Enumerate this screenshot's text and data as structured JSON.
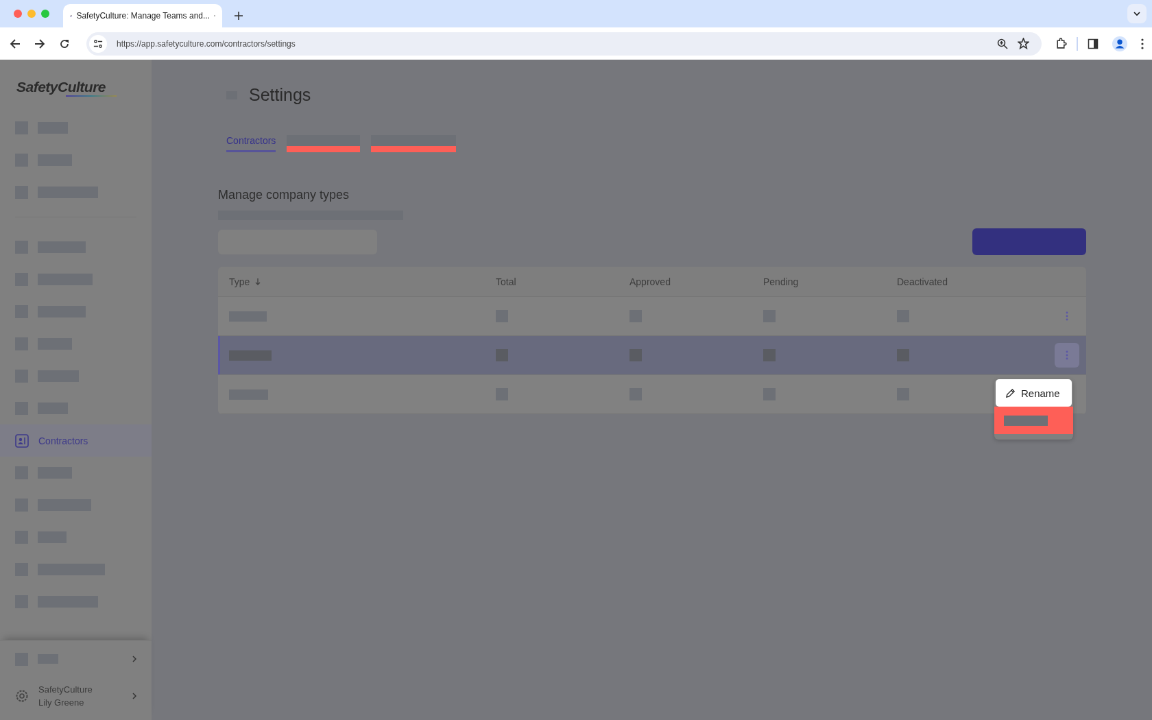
{
  "browser": {
    "tab_title": "SafetyCulture: Manage Teams and...",
    "url": "https://app.safetyculture.com/contractors/settings"
  },
  "sidebar": {
    "logo": "SafetyCulture",
    "items": [
      {
        "kind": "redacted",
        "selected": false
      },
      {
        "kind": "redacted",
        "selected": false
      },
      {
        "kind": "redacted",
        "selected": false
      },
      {
        "kind": "divider"
      },
      {
        "kind": "redacted",
        "selected": false
      },
      {
        "kind": "redacted",
        "selected": false
      },
      {
        "kind": "redacted",
        "selected": false
      },
      {
        "kind": "redacted",
        "selected": false
      },
      {
        "kind": "redacted",
        "selected": false
      },
      {
        "kind": "redacted",
        "selected": false
      },
      {
        "kind": "link",
        "label": "Contractors",
        "selected": true
      },
      {
        "kind": "redacted",
        "selected": false
      },
      {
        "kind": "redacted",
        "selected": false
      },
      {
        "kind": "redacted",
        "selected": false
      },
      {
        "kind": "redacted",
        "selected": false
      },
      {
        "kind": "redacted",
        "selected": false
      }
    ],
    "footer": {
      "organization": "SafetyCulture",
      "user": "Lily Greene"
    }
  },
  "page": {
    "title": "Settings",
    "tabs": [
      {
        "kind": "link",
        "label": "Contractors",
        "selected": true
      },
      {
        "kind": "redacted",
        "selected": false
      },
      {
        "kind": "redacted",
        "selected": false
      }
    ],
    "section_title": "Manage company types",
    "table": {
      "columns": [
        {
          "label": "Type",
          "sorted": true
        },
        {
          "label": "Total",
          "sorted": false
        },
        {
          "label": "Approved",
          "sorted": false
        },
        {
          "label": "Pending",
          "sorted": false
        },
        {
          "label": "Deactivated",
          "sorted": false
        }
      ],
      "rows": [
        {
          "selected": false
        },
        {
          "selected": true
        },
        {
          "selected": false
        }
      ]
    },
    "menu": {
      "items": [
        {
          "kind": "item",
          "label": "Rename"
        },
        {
          "kind": "redacted"
        }
      ]
    }
  }
}
